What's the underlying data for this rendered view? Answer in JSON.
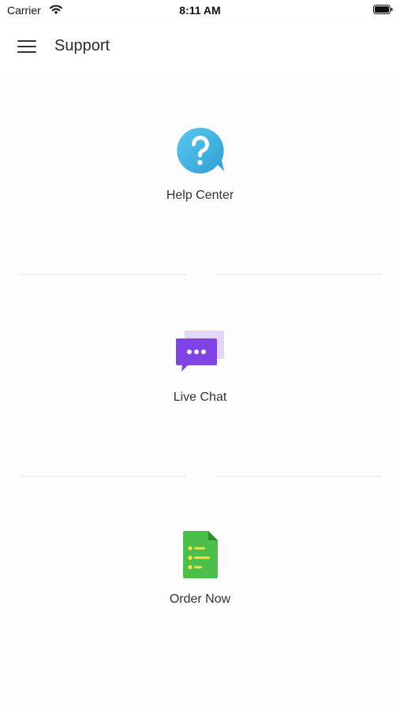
{
  "status_bar": {
    "carrier": "Carrier",
    "time": "8:11 AM"
  },
  "header": {
    "title": "Support",
    "menu_icon": "hamburger-menu-icon"
  },
  "options": [
    {
      "label": "Help Center",
      "icon": "help-question-bubble-icon",
      "color": "#3fb2e0"
    },
    {
      "label": "Live Chat",
      "icon": "chat-bubbles-icon",
      "color": "#7b3fe0"
    },
    {
      "label": "Order Now",
      "icon": "order-document-icon",
      "color": "#4cbf4b"
    }
  ],
  "colors": {
    "background": "#ffffff",
    "divider": "#f1f1f3"
  }
}
